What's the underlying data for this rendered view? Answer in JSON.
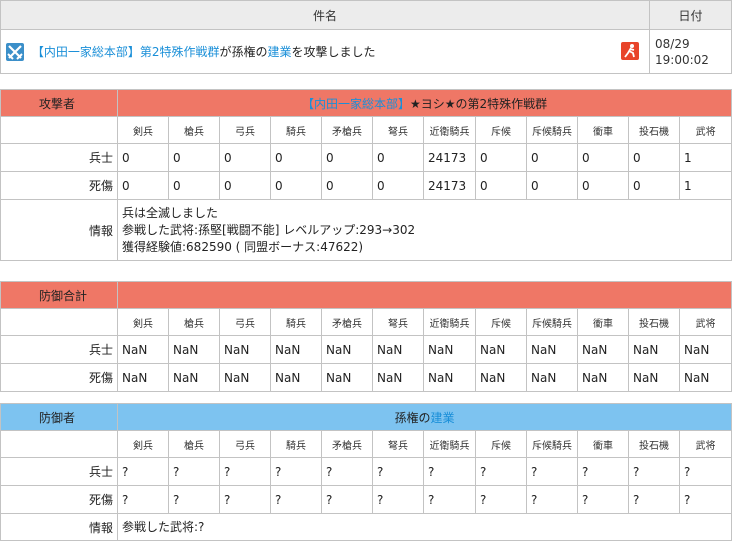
{
  "header": {
    "subject_label": "件名",
    "date_label": "日付"
  },
  "message": {
    "prefix": "【内田一家総本部】",
    "unit": "第2特殊作戦群",
    "middle": "が孫権の",
    "target": "建業",
    "suffix": "を攻撃しました",
    "date": "08/29",
    "time": "19:00:02"
  },
  "columns": [
    "剣兵",
    "槍兵",
    "弓兵",
    "騎兵",
    "矛槍兵",
    "弩兵",
    "近衛騎兵",
    "斥候",
    "斥候騎兵",
    "衝車",
    "投石機",
    "武将"
  ],
  "attacker": {
    "label": "攻撃者",
    "title_bracket": "【内田一家総本部】",
    "title_rest": "★ヨシ★の第2特殊作戦群",
    "soldiers_label": "兵士",
    "soldiers": [
      "0",
      "0",
      "0",
      "0",
      "0",
      "0",
      "24173",
      "0",
      "0",
      "0",
      "0",
      "1"
    ],
    "casualties_label": "死傷",
    "casualties": [
      "0",
      "0",
      "0",
      "0",
      "0",
      "0",
      "24173",
      "0",
      "0",
      "0",
      "0",
      "1"
    ],
    "info_label": "情報",
    "info_lines": [
      "兵は全滅しました",
      "参戦した武将:孫堅[戦闘不能] レベルアップ:293→302",
      "獲得経験値:682590 ( 同盟ボーナス:47622)"
    ]
  },
  "defense_total": {
    "label": "防御合計",
    "soldiers_label": "兵士",
    "soldiers": [
      "NaN",
      "NaN",
      "NaN",
      "NaN",
      "NaN",
      "NaN",
      "NaN",
      "NaN",
      "NaN",
      "NaN",
      "NaN",
      "NaN"
    ],
    "casualties_label": "死傷",
    "casualties": [
      "NaN",
      "NaN",
      "NaN",
      "NaN",
      "NaN",
      "NaN",
      "NaN",
      "NaN",
      "NaN",
      "NaN",
      "NaN",
      "NaN"
    ]
  },
  "defender": {
    "label": "防御者",
    "title_owner": "孫権の",
    "title_city": "建業",
    "soldiers_label": "兵士",
    "soldiers": [
      "?",
      "?",
      "?",
      "?",
      "?",
      "?",
      "?",
      "?",
      "?",
      "?",
      "?",
      "?"
    ],
    "casualties_label": "死傷",
    "casualties": [
      "?",
      "?",
      "?",
      "?",
      "?",
      "?",
      "?",
      "?",
      "?",
      "?",
      "?",
      "?"
    ],
    "info_label": "情報",
    "info_lines": [
      "参戦した武将:?"
    ]
  },
  "colors": {
    "attack_header": "#ef7766",
    "defender_header": "#7dc3f0",
    "link": "#1a8fd8"
  },
  "icons": {
    "message_icon": "crossed-swords-icon",
    "status_icon": "attack-runner-icon"
  }
}
